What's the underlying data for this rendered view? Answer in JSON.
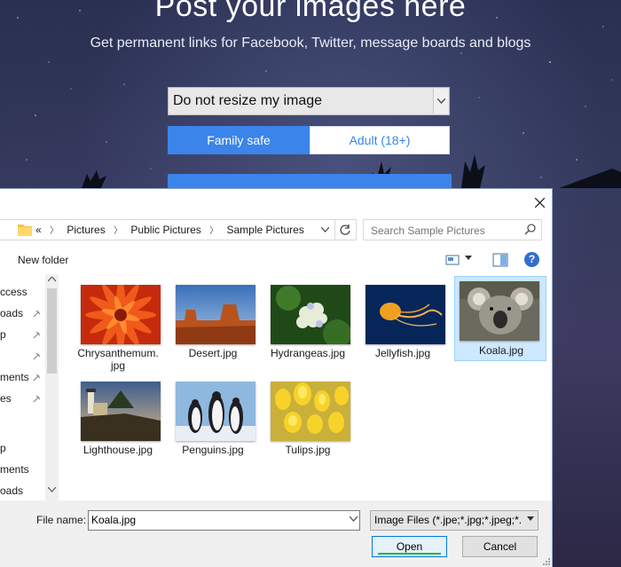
{
  "site": {
    "title": "Post your images here",
    "subtitle": "Get permanent links for Facebook, Twitter, message boards and blogs",
    "resize_option": "Do not resize my image",
    "safety_options": [
      "Family safe",
      "Adult (18+)"
    ],
    "accent_color": "#3b84ea"
  },
  "dialog": {
    "breadcrumb": {
      "overflow": "«",
      "items": [
        "Pictures",
        "Public Pictures",
        "Sample Pictures"
      ]
    },
    "search_placeholder": "Search Sample Pictures",
    "new_folder_label": "New folder",
    "help_label": "?",
    "nav_items": [
      "ccess",
      "oads",
      "p",
      "",
      "ments",
      "es",
      "",
      "p",
      "ments",
      "oads"
    ],
    "files": [
      {
        "name": "Chrysanthemum.jpg",
        "line1": "Chrysanthemum.",
        "line2": "jpg",
        "selected": false,
        "thumb": "chrysanthemum"
      },
      {
        "name": "Desert.jpg",
        "line1": "Desert.jpg",
        "line2": "",
        "selected": false,
        "thumb": "desert"
      },
      {
        "name": "Hydrangeas.jpg",
        "line1": "Hydrangeas.jpg",
        "line2": "",
        "selected": false,
        "thumb": "hydrangeas"
      },
      {
        "name": "Jellyfish.jpg",
        "line1": "Jellyfish.jpg",
        "line2": "",
        "selected": false,
        "thumb": "jellyfish"
      },
      {
        "name": "Koala.jpg",
        "line1": "Koala.jpg",
        "line2": "",
        "selected": true,
        "thumb": "koala"
      },
      {
        "name": "Lighthouse.jpg",
        "line1": "Lighthouse.jpg",
        "line2": "",
        "selected": false,
        "thumb": "lighthouse"
      },
      {
        "name": "Penguins.jpg",
        "line1": "Penguins.jpg",
        "line2": "",
        "selected": false,
        "thumb": "penguins"
      },
      {
        "name": "Tulips.jpg",
        "line1": "Tulips.jpg",
        "line2": "",
        "selected": false,
        "thumb": "tulips"
      }
    ],
    "file_name_label": "File name:",
    "file_name_value": "Koala.jpg",
    "file_type_value": "Image Files (*.jpe;*.jpg;*.jpeg;*.",
    "open_label": "Open",
    "cancel_label": "Cancel",
    "selection_color": "#cde8ff"
  }
}
